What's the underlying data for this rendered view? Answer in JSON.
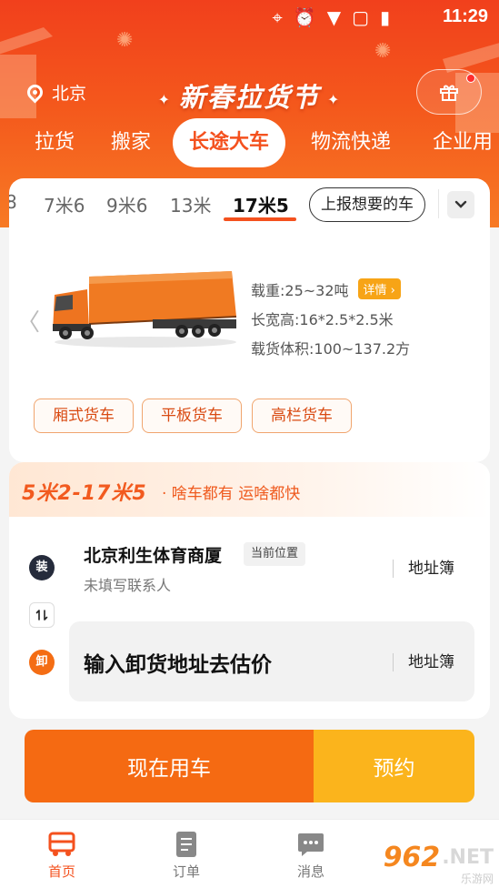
{
  "status_bar": {
    "time": "11:29"
  },
  "header": {
    "city": "北京",
    "festival": "新春拉货节",
    "tabs": [
      "拉货",
      "搬家",
      "长途大车",
      "物流快递",
      "企业用"
    ]
  },
  "vehicle_sizes": {
    "items": [
      "8",
      "7米6",
      "9米6",
      "13米",
      "17米5"
    ],
    "selected": "17米5",
    "report_button": "上报想要的车"
  },
  "vehicle": {
    "load": "载重:25~32吨",
    "detail": "详情",
    "dimensions": "长宽高:16*2.5*2.5米",
    "volume": "载货体积:100~137.2方",
    "types": [
      "厢式货车",
      "平板货车",
      "高栏货车"
    ]
  },
  "slogan": {
    "range": "5米2-17米5",
    "tagline": "· 啥车都有 运啥都快"
  },
  "order": {
    "load_badge": "装",
    "load_title": "北京利生体育商厦",
    "current_location": "当前位置",
    "load_contact": "未填写联系人",
    "address_book": "地址簿",
    "unload_badge": "卸",
    "unload_placeholder": "输入卸货地址去估价"
  },
  "actions": {
    "now": "现在用车",
    "book": "预约"
  },
  "nav": {
    "items": [
      "首页",
      "订单",
      "消息"
    ]
  },
  "watermark": {
    "brand": "962",
    "net": ".NET",
    "sub": "乐游网"
  },
  "colors": {
    "accent": "#f4511e",
    "now_button": "#f56a12",
    "book_button": "#fbb41c"
  }
}
